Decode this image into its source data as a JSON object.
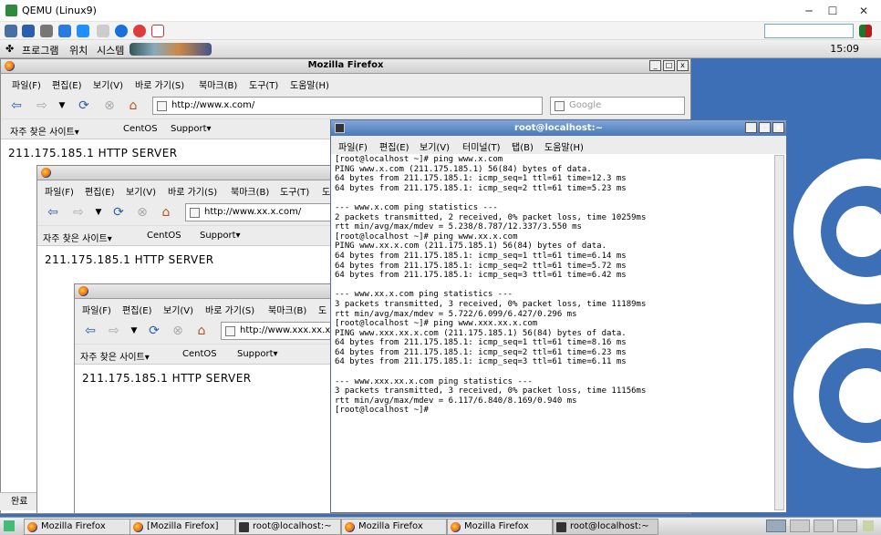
{
  "qemu": {
    "title": "QEMU (Linux9)",
    "controls": {
      "minimize": "─",
      "maximize": "☐",
      "close": "✕"
    }
  },
  "guest_panel": {
    "menus": [
      "프로그램",
      "위치",
      "시스템"
    ],
    "clock": "15:09"
  },
  "ff_windows": [
    {
      "title": "Mozilla Firefox",
      "menu": [
        "파일(F)",
        "편집(E)",
        "보기(V)",
        "바로 가기(S)",
        "북마크(B)",
        "도구(T)",
        "도움말(H)"
      ],
      "url": "http://www.x.com/",
      "search_placeholder": "Google",
      "bookmarks": [
        "자주 찾은 사이트▾",
        "CentOS",
        "Support▾"
      ],
      "content": "211.175.185.1 HTTP SERVER"
    },
    {
      "title": "",
      "menu": [
        "파일(F)",
        "편집(E)",
        "보기(V)",
        "바로 가기(S)",
        "북마크(B)",
        "도구(T)",
        "도"
      ],
      "url": "http://www.xx.x.com/",
      "bookmarks": [
        "자주 찾은 사이트▾",
        "CentOS",
        "Support▾"
      ],
      "content": "211.175.185.1 HTTP SERVER"
    },
    {
      "title": "",
      "menu": [
        "파일(F)",
        "편집(E)",
        "보기(V)",
        "바로 가기(S)",
        "북마크(B)",
        "도"
      ],
      "url": "http://www.xxx.xx.x",
      "bookmarks": [
        "자주 찾은 사이트▾",
        "CentOS",
        "Support▾"
      ],
      "content": "211.175.185.1 HTTP SERVER"
    }
  ],
  "terminal": {
    "title": "root@localhost:~",
    "menu": [
      "파일(F)",
      "편집(E)",
      "보기(V)",
      "터미널(T)",
      "탭(B)",
      "도움말(H)"
    ],
    "output": "[root@localhost ~]# ping www.x.com\nPING www.x.com (211.175.185.1) 56(84) bytes of data.\n64 bytes from 211.175.185.1: icmp_seq=1 ttl=61 time=12.3 ms\n64 bytes from 211.175.185.1: icmp_seq=2 ttl=61 time=5.23 ms\n\n--- www.x.com ping statistics ---\n2 packets transmitted, 2 received, 0% packet loss, time 10259ms\nrtt min/avg/max/mdev = 5.238/8.787/12.337/3.550 ms\n[root@localhost ~]# ping www.xx.x.com\nPING www.xx.x.com (211.175.185.1) 56(84) bytes of data.\n64 bytes from 211.175.185.1: icmp_seq=1 ttl=61 time=6.14 ms\n64 bytes from 211.175.185.1: icmp_seq=2 ttl=61 time=5.72 ms\n64 bytes from 211.175.185.1: icmp_seq=3 ttl=61 time=6.42 ms\n\n--- www.xx.x.com ping statistics ---\n3 packets transmitted, 3 received, 0% packet loss, time 11189ms\nrtt min/avg/max/mdev = 5.722/6.099/6.427/0.296 ms\n[root@localhost ~]# ping www.xxx.xx.x.com\nPING www.xxx.xx.x.com (211.175.185.1) 56(84) bytes of data.\n64 bytes from 211.175.185.1: icmp_seq=1 ttl=61 time=8.16 ms\n64 bytes from 211.175.185.1: icmp_seq=2 ttl=61 time=6.23 ms\n64 bytes from 211.175.185.1: icmp_seq=3 ttl=61 time=6.11 ms\n\n--- www.xxx.xx.x.com ping statistics ---\n3 packets transmitted, 3 received, 0% packet loss, time 11156ms\nrtt min/avg/max/mdev = 6.117/6.840/8.169/0.940 ms\n[root@localhost ~]#"
  },
  "status": "완료",
  "taskbar": [
    "Mozilla Firefox",
    "[Mozilla Firefox]",
    "root@localhost:~",
    "Mozilla Firefox",
    "Mozilla Firefox",
    "root@localhost:~"
  ],
  "colors": {
    "desktop": "#3d6fb6",
    "terminal_title": "#4a78b8"
  }
}
